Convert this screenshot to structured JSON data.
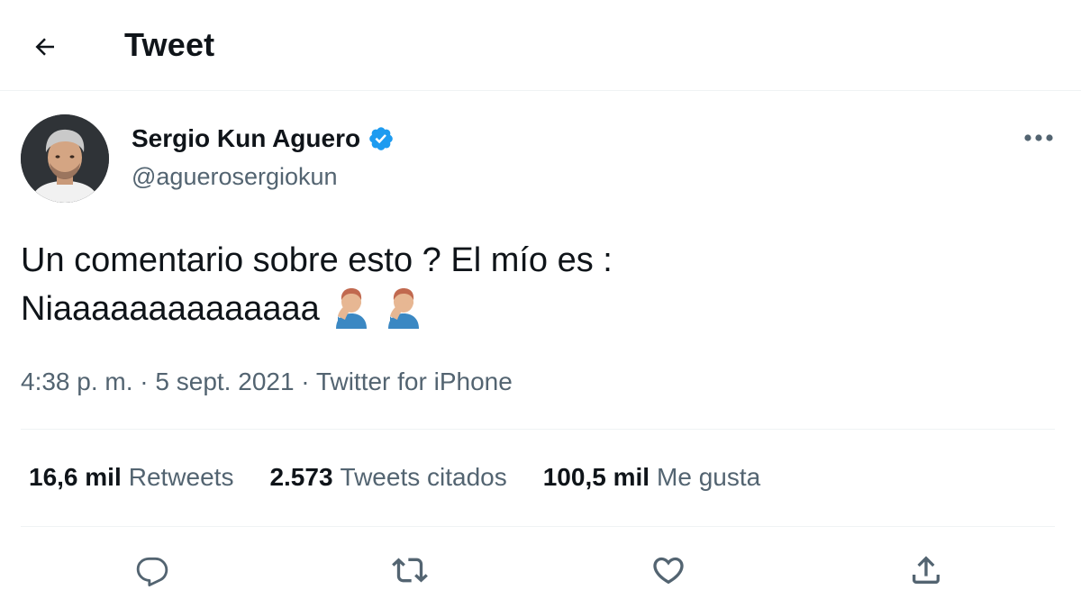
{
  "header": {
    "back_icon": "arrow-left-icon",
    "title": "Tweet"
  },
  "author": {
    "name": "Sergio Kun Aguero",
    "handle": "@aguerosergiokun",
    "verified": true,
    "avatar_icon": "profile-photo",
    "more_icon": "more-horizontal-icon"
  },
  "tweet": {
    "line1": "Un comentario sobre esto ? El mío es :",
    "line2": "Niaaaaaaaaaaaaaa",
    "emoji": [
      "facepalm-emoji",
      "facepalm-emoji"
    ]
  },
  "meta": {
    "time": "4:38 p. m.",
    "separator": " · ",
    "date": "5 sept. 2021",
    "source": "Twitter for iPhone"
  },
  "stats": {
    "retweets_count": "16,6 mil",
    "retweets_label": "Retweets",
    "quotes_count": "2.573",
    "quotes_label": "Tweets citados",
    "likes_count": "100,5 mil",
    "likes_label": "Me gusta"
  },
  "actions": [
    {
      "icon": "reply-icon"
    },
    {
      "icon": "retweet-icon"
    },
    {
      "icon": "like-icon"
    },
    {
      "icon": "share-icon"
    }
  ],
  "colors": {
    "text_primary": "#0f1419",
    "text_secondary": "#536471",
    "verified_blue": "#1d9bf0",
    "divider": "#eff3f4"
  }
}
